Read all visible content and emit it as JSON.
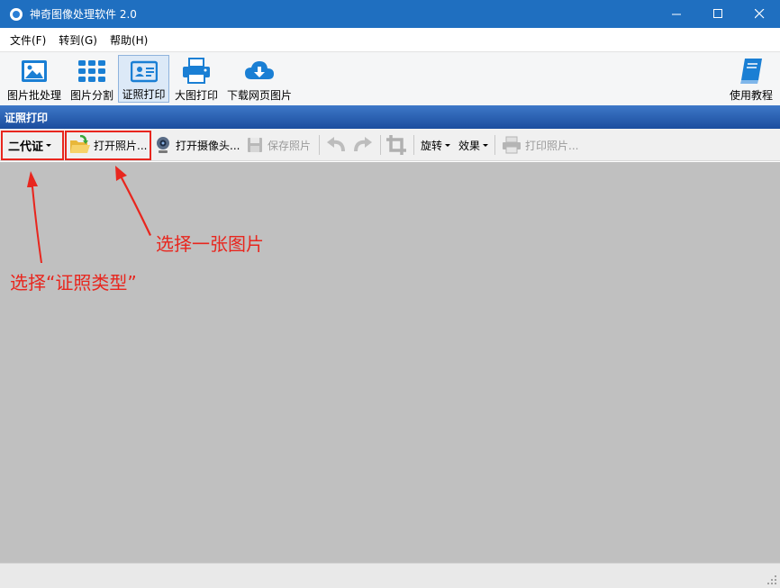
{
  "window": {
    "title": "神奇图像处理软件 2.0",
    "controls": {
      "minimize": "—",
      "maximize": "☐",
      "close": "✕"
    }
  },
  "menu": [
    {
      "label": "文件(F)"
    },
    {
      "label": "转到(G)"
    },
    {
      "label": "帮助(H)"
    }
  ],
  "ribbon": {
    "items": [
      {
        "label": "图片批处理",
        "icon": "image-icon"
      },
      {
        "label": "图片分割",
        "icon": "grid-icon"
      },
      {
        "label": "证照打印",
        "icon": "id-card-icon",
        "active": true
      },
      {
        "label": "大图打印",
        "icon": "printer-icon"
      },
      {
        "label": "下载网页图片",
        "icon": "cloud-download-icon"
      }
    ],
    "help": {
      "label": "使用教程",
      "icon": "book-icon"
    }
  },
  "section": {
    "title": "证照打印"
  },
  "toolbar": {
    "id_type": "二代证",
    "open_photo": "打开照片...",
    "open_camera": "打开摄像头...",
    "save_photo": "保存照片",
    "rotate": "旋转",
    "effects": "效果",
    "print_photo": "打印照片..."
  },
  "annotations": {
    "select_type": "选择“证照类型”",
    "select_image": "选择一张图片"
  },
  "colors": {
    "titlebar": "#1f6fc0",
    "section_header": "#2a5fb0",
    "annotation": "#e8261e",
    "canvas": "#c0c0c0",
    "icon_blue": "#1a7fd4"
  }
}
